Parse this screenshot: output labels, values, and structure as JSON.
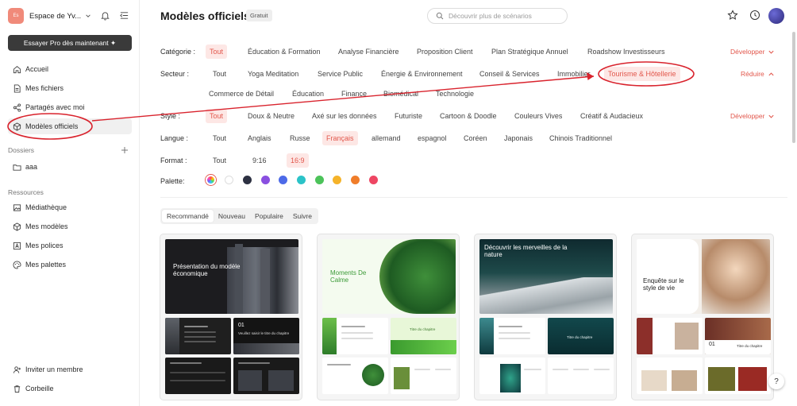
{
  "workspace": {
    "avatar": "Es",
    "name": "Espace de Yv..."
  },
  "sidebar": {
    "pro_button": "Essayer Pro dès maintenant ✦",
    "nav": [
      {
        "label": "Accueil",
        "icon": "home-icon"
      },
      {
        "label": "Mes fichiers",
        "icon": "file-icon"
      },
      {
        "label": "Partagés avec moi",
        "icon": "share-icon"
      },
      {
        "label": "Modèles officiels",
        "icon": "templates-icon"
      }
    ],
    "folders_label": "Dossiers",
    "folders": [
      {
        "label": "aaa",
        "icon": "folder-icon"
      }
    ],
    "resources_label": "Ressources",
    "resources": [
      {
        "label": "Médiathèque",
        "icon": "image-icon"
      },
      {
        "label": "Mes modèles",
        "icon": "cube-icon"
      },
      {
        "label": "Mes polices",
        "icon": "font-icon"
      },
      {
        "label": "Mes palettes",
        "icon": "palette-icon"
      }
    ],
    "bottom": [
      {
        "label": "Inviter un membre",
        "icon": "invite-icon"
      },
      {
        "label": "Corbeille",
        "icon": "trash-icon"
      }
    ]
  },
  "header": {
    "title": "Modèles officiels",
    "badge": "Gratuit",
    "search_placeholder": "Découvrir plus de scénarios"
  },
  "filters": {
    "categorie": {
      "label": "Catégorie :",
      "options": [
        "Tout",
        "Éducation & Formation",
        "Analyse Financière",
        "Proposition Client",
        "Plan Stratégique Annuel",
        "Roadshow Investisseurs"
      ],
      "selected": "Tout",
      "toggle": "Développer"
    },
    "secteur": {
      "label": "Secteur :",
      "options": [
        "Tout",
        "Yoga Meditation",
        "Service Public",
        "Énergie & Environnement",
        "Conseil & Services",
        "Immobilier",
        "Tourisme & Hôtellerie",
        "Commerce de Détail",
        "Éducation",
        "Finance",
        "Biomédical",
        "Technologie"
      ],
      "selected": "Tourisme & Hôtellerie",
      "toggle": "Réduire"
    },
    "style": {
      "label": "Style :",
      "options": [
        "Tout",
        "Doux & Neutre",
        "Axé sur les données",
        "Futuriste",
        "Cartoon & Doodle",
        "Couleurs Vives",
        "Créatif & Audacieux"
      ],
      "selected": "Tout",
      "toggle": "Développer"
    },
    "langue": {
      "label": "Langue :",
      "options": [
        "Tout",
        "Anglais",
        "Russe",
        "Français",
        "allemand",
        "espagnol",
        "Coréen",
        "Japonais",
        "Chinois Traditionnel"
      ],
      "selected": "Français"
    },
    "format": {
      "label": "Format :",
      "options": [
        "Tout",
        "9:16",
        "16:9"
      ],
      "selected": "16:9"
    },
    "palette": {
      "label": "Palette:",
      "colors": [
        "rainbow",
        "#ffffff",
        "#2d3142",
        "#8a4fe0",
        "#4d6ae8",
        "#2bc3c8",
        "#4cc35a",
        "#f5b32a",
        "#f07d2a",
        "#ee4663"
      ]
    }
  },
  "tabs": [
    "Recommandé",
    "Nouveau",
    "Populaire",
    "Suivre"
  ],
  "cards": [
    {
      "title": "Présentation du modèle économique",
      "sm1": "Veuillez saisir le titre du chapitre",
      "sm_num": "01"
    },
    {
      "title": "Moments De Calme",
      "sm1": "Titre du chapitre"
    },
    {
      "title": "Découvrir les merveilles de la nature",
      "sm1": "Titre du chapitre"
    },
    {
      "title": "Enquête sur le style de vie",
      "sm1": "Titre du chapitre",
      "sm_num": "01"
    }
  ],
  "colors": {
    "accent": "#e2574c",
    "accent_bg": "#fde7e5",
    "annotation": "#d9232d"
  }
}
